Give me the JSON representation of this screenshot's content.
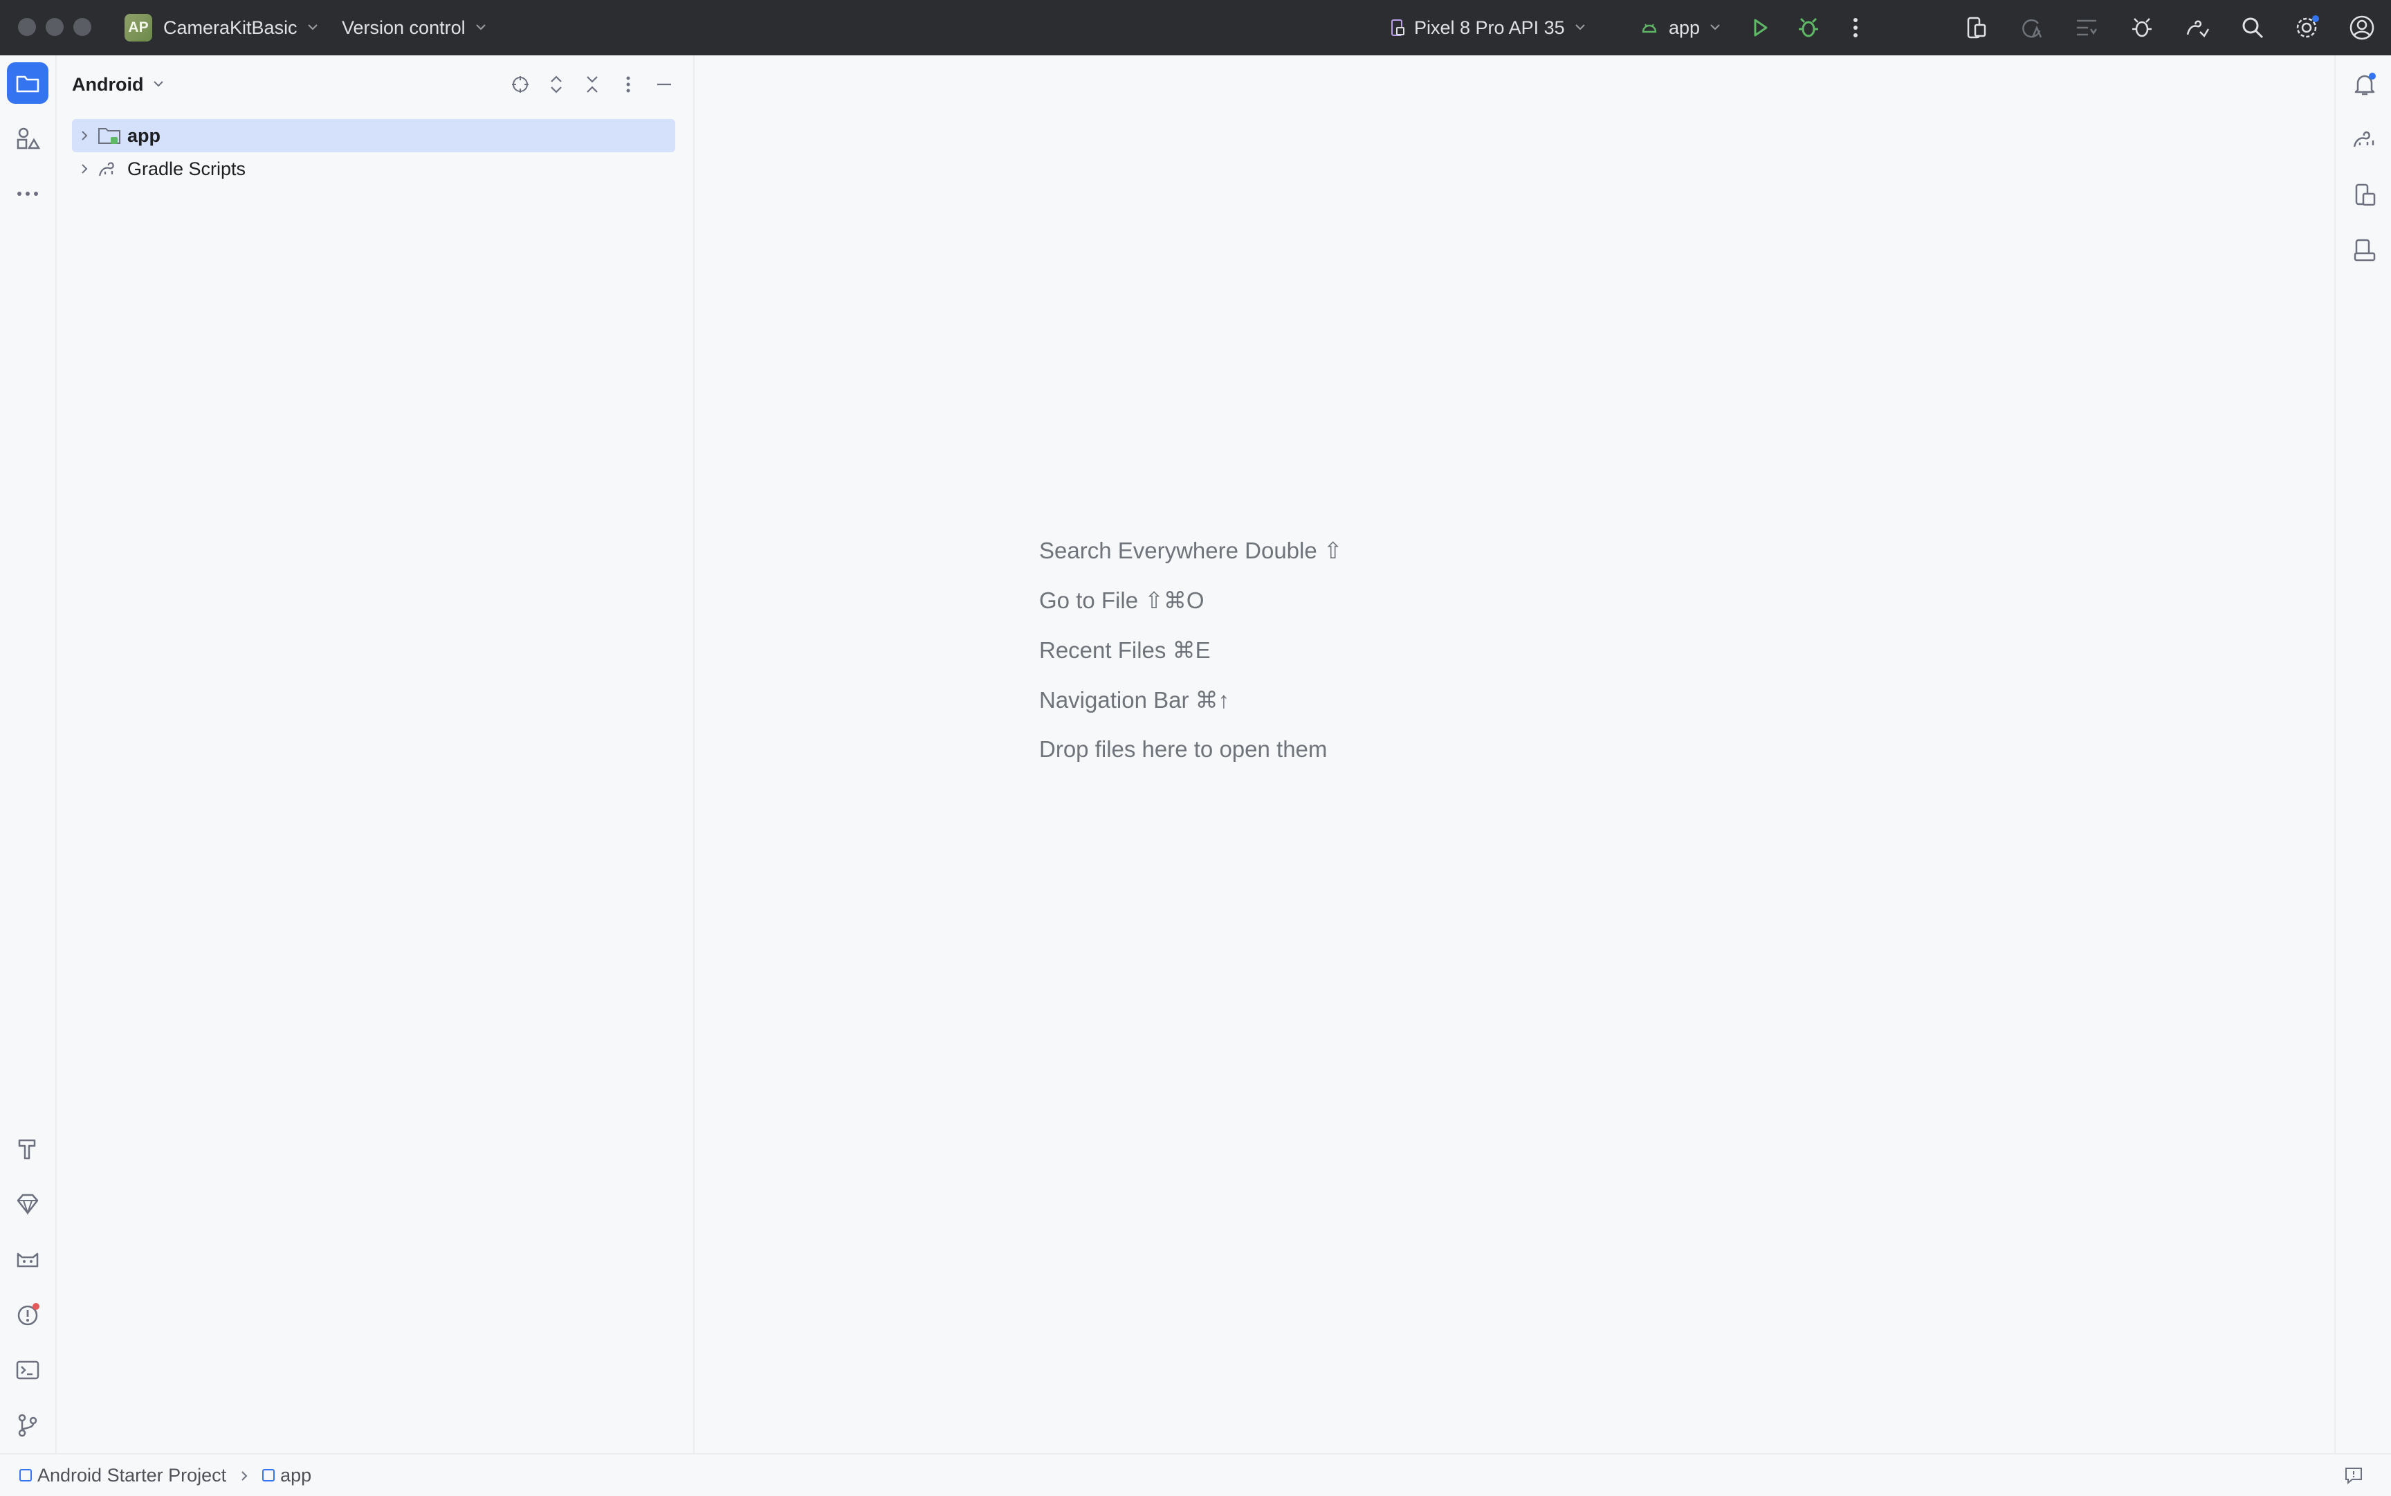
{
  "titlebar": {
    "project_badge": "AP",
    "project_name": "CameraKitBasic",
    "vcs_label": "Version control",
    "device": "Pixel 8 Pro API 35",
    "run_config": "app"
  },
  "icons": {
    "traffic_lights": [
      "close-window-icon",
      "minimize-window-icon",
      "zoom-window-icon"
    ],
    "toolbar": [
      "device-manager-icon",
      "apply-changes-icon",
      "build-variants-icon",
      "app-inspection-icon",
      "gradle-sync-icon",
      "search-icon",
      "settings-icon",
      "account-icon"
    ],
    "left_strip_top": [
      "project-folder-icon",
      "resource-manager-icon",
      "more-tools-icon"
    ],
    "left_strip_bottom": [
      "build-hammer-icon",
      "gem-icon",
      "logcat-icon",
      "problems-icon",
      "terminal-icon",
      "git-branch-icon"
    ],
    "right_strip": [
      "notifications-icon",
      "gradle-icon",
      "device-manager-icon",
      "running-devices-icon"
    ]
  },
  "project_panel": {
    "view_mode": "Android",
    "tree": [
      {
        "label": "app",
        "icon": "module-folder-icon",
        "selected": true
      },
      {
        "label": "Gradle Scripts",
        "icon": "gradle-icon",
        "selected": false
      }
    ]
  },
  "editor": {
    "hints": [
      "Search Everywhere Double ⇧",
      "Go to File ⇧⌘O",
      "Recent Files ⌘E",
      "Navigation Bar ⌘↑",
      "Drop files here to open them"
    ]
  },
  "statusbar": {
    "crumbs": [
      "Android Starter Project",
      "app"
    ]
  },
  "colors": {
    "titlebar_bg": "#2b2d30",
    "accent": "#3574f0",
    "selection": "#d5e1fa",
    "run_green": "#5fb865",
    "notification_dot": "#3574f0",
    "problems_dot": "#e55b5b"
  }
}
